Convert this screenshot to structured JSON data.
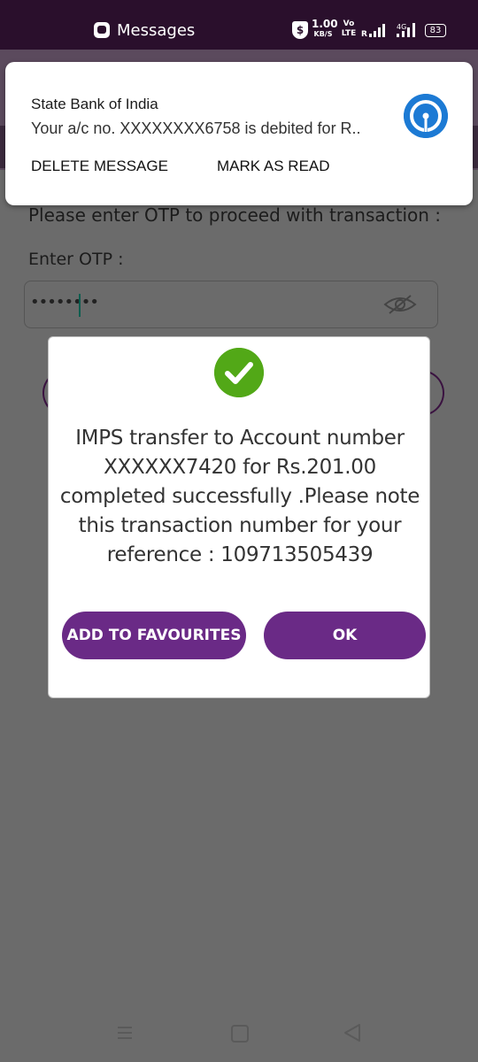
{
  "status_bar": {
    "app_name": "Messages",
    "shield_symbol": "$",
    "speed_value": "1.00",
    "speed_unit": "KB/S",
    "volte_top": "Vo",
    "volte_bottom": "LTE",
    "sim2_network": "4G",
    "battery": "83"
  },
  "background_app": {
    "otp_prompt": "Please enter OTP to proceed with transaction :",
    "otp_label": "Enter OTP :",
    "otp_value": "••••••••"
  },
  "notification": {
    "sender": "State Bank of India",
    "preview": "Your a/c no. XXXXXXXX6758 is debited for R..",
    "actions": [
      "DELETE MESSAGE",
      "MARK AS READ"
    ],
    "logo_icon": "sbi-logo-icon",
    "logo_color": "#1c7ad4"
  },
  "dialog": {
    "message": "IMPS transfer to Account number XXXXXX7420 for Rs.201.00 completed successfully .Please note this transaction number for your reference : 109713505439",
    "add_favourites_label": "ADD TO FAVOURITES",
    "ok_label": "OK",
    "icon": "check-circle-icon",
    "accent_color": "#6a2a86",
    "success_color": "#52a817"
  },
  "nav_bar": {
    "icons": [
      "recents-icon",
      "home-icon",
      "back-icon"
    ]
  }
}
